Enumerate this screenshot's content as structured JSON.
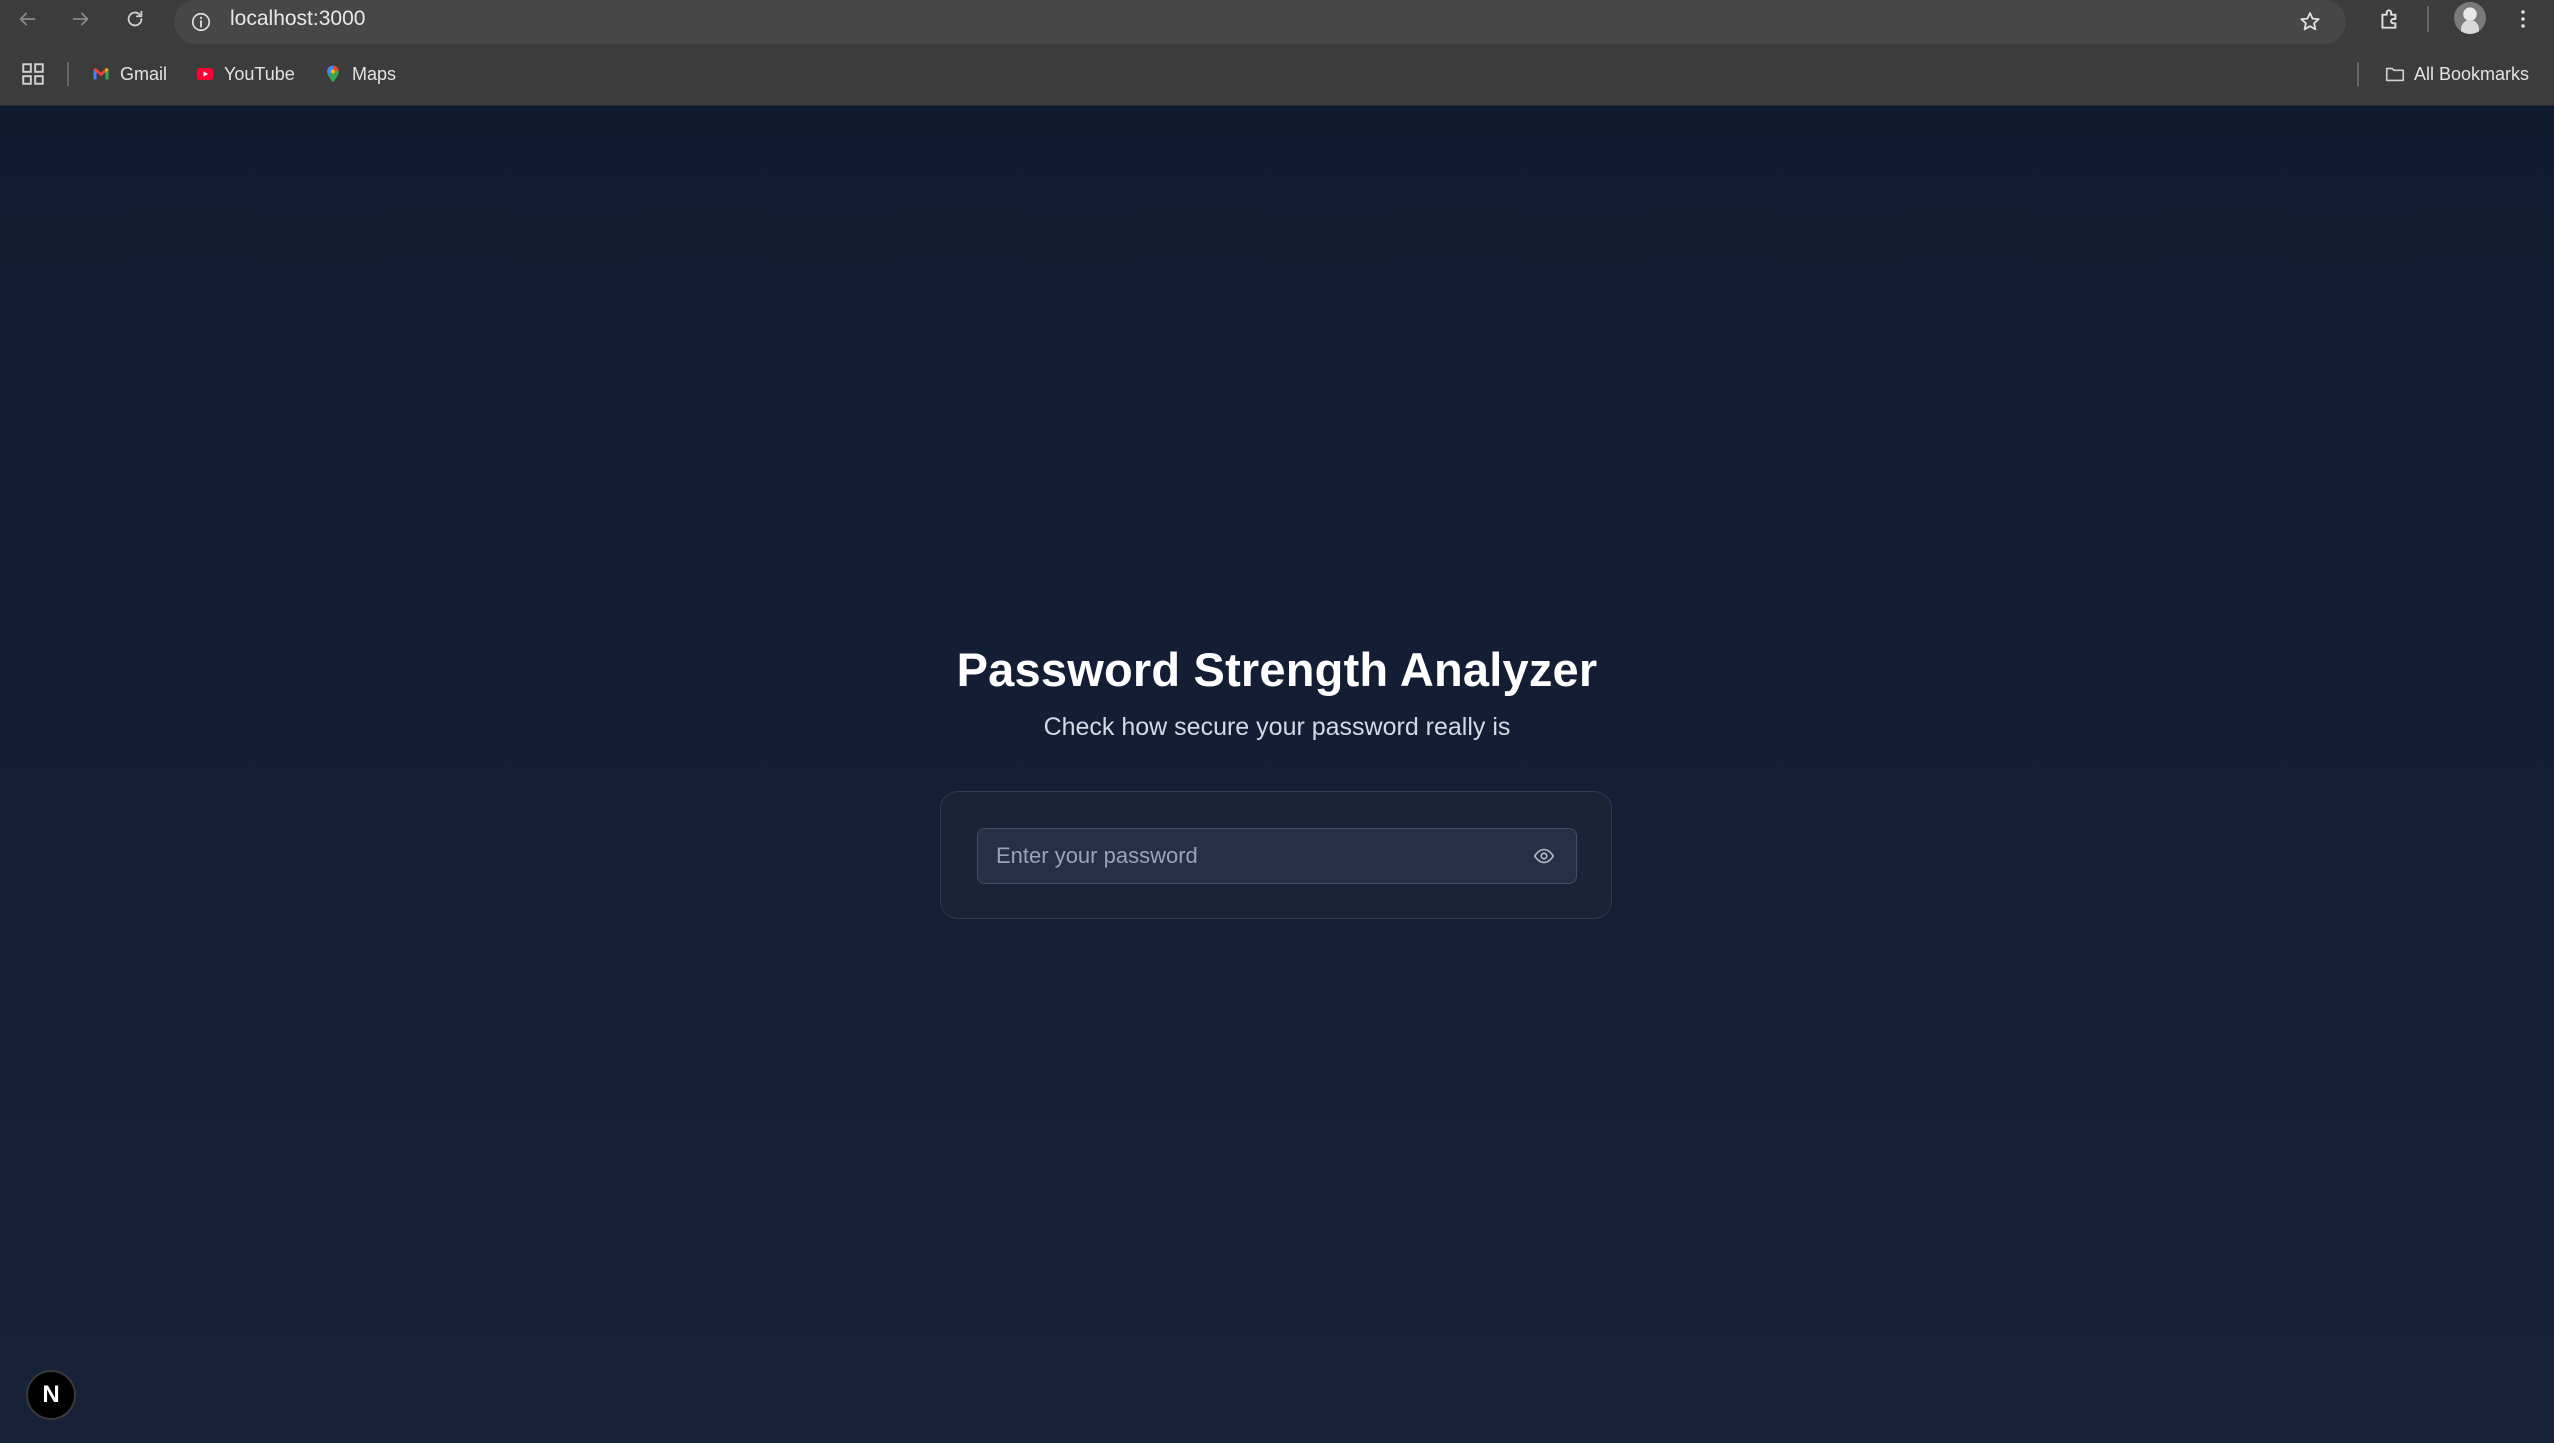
{
  "browser": {
    "url": "localhost:3000",
    "bookmarks": [
      {
        "label": "Gmail",
        "icon": "gmail-icon"
      },
      {
        "label": "YouTube",
        "icon": "youtube-icon"
      },
      {
        "label": "Maps",
        "icon": "maps-icon"
      }
    ],
    "all_bookmarks_label": "All Bookmarks"
  },
  "page": {
    "title": "Password Strength Analyzer",
    "subtitle": "Check how secure your password really is",
    "password_input": {
      "value": "",
      "placeholder": "Enter your password"
    },
    "badge_letter": "N"
  },
  "colors": {
    "background": "#131e35",
    "card": "#1a2437",
    "input": "#243046",
    "title": "#ffffff",
    "subtitle": "#d2dae6"
  }
}
